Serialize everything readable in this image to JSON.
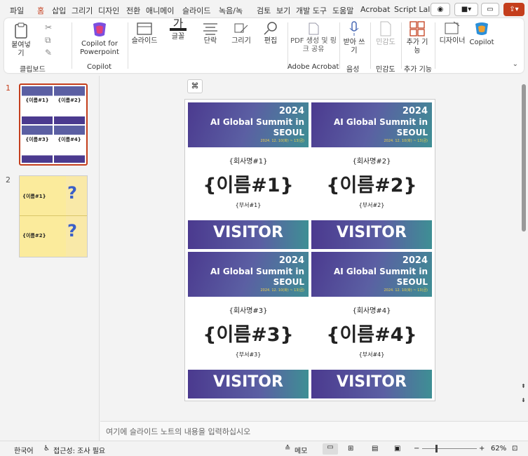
{
  "tabs": [
    "파일",
    "홈",
    "삽입",
    "그리기",
    "디자인",
    "전환",
    "애니메이",
    "슬라이드",
    "녹음/녹",
    "검토",
    "보기",
    "개발 도구",
    "도움말",
    "Acrobat",
    "Script Lal"
  ],
  "ribbon": {
    "paste": "붙여넣기",
    "copilot_pp": "Copilot for Powerpoint",
    "slide": "슬라이드",
    "font": "글꼴",
    "paragraph": "단락",
    "drawing": "그리기",
    "editing": "편집",
    "pdf": "PDF 생성 및 링크 공유",
    "dictate": "받아 쓰기",
    "sensitivity": "민감도",
    "addins": "추가 기능",
    "designer": "디자이너",
    "copilot": "Copilot",
    "groups": [
      "클립보드",
      "Copilot",
      "Adobe Acrobat",
      "음성",
      "민감도",
      "추가 기능"
    ]
  },
  "thumbs": {
    "n1": "1",
    "n2": "2",
    "t1": [
      "{이름#1}",
      "{이름#2}",
      "{이름#3}",
      "{이름#4}"
    ],
    "v": "VISITOR",
    "t2": [
      "{이름#1}",
      "{이름#2}"
    ]
  },
  "badges": [
    {
      "year": "2024",
      "title": "AI Global Summit in SEOUL",
      "date": "2024. 12. 10(화) ~ 13(금)",
      "company": "{회사명#1}",
      "name": "{이름#1}",
      "dept": "{부서#1}",
      "visitor": "VISITOR"
    },
    {
      "year": "2024",
      "title": "AI Global Summit in SEOUL",
      "date": "2024. 12. 10(화) ~ 13(금)",
      "company": "{회사명#2}",
      "name": "{이름#2}",
      "dept": "{부서#2}",
      "visitor": "VISITOR"
    },
    {
      "year": "2024",
      "title": "AI Global Summit in SEOUL",
      "date": "2024. 12. 10(화) ~ 13(금)",
      "company": "{회사명#3}",
      "name": "{이름#3}",
      "dept": "{부서#3}",
      "visitor": "VISITOR"
    },
    {
      "year": "2024",
      "title": "AI Global Summit in SEOUL",
      "date": "2024. 12. 10(화) ~ 13(금)",
      "company": "{회사명#4}",
      "name": "{이름#4}",
      "dept": "{부서#4}",
      "visitor": "VISITOR"
    }
  ],
  "notes_placeholder": "여기에 슬라이드 노트의 내용을 입력하십시오",
  "status": {
    "language": "한국어",
    "accessibility": "접근성: 조사 필요",
    "notes": "메모",
    "zoom": "62%"
  },
  "colors": {
    "accent": "#c43e1c",
    "badge_purple": "#4b3a8f",
    "badge_teal": "#3e8f94",
    "gold": "#f2d24a"
  },
  "icons": [
    "record-icon",
    "camera-icon",
    "comment-icon",
    "share-icon",
    "clipboard-icon",
    "cut-icon",
    "copy-icon",
    "format-painter-icon",
    "copilot-icon",
    "slide-layout-icon",
    "font-icon",
    "paragraph-icon",
    "draw-icon",
    "search-icon",
    "pdf-icon",
    "mic-icon",
    "sensitivity-icon",
    "addins-icon",
    "designer-icon",
    "chevron-down-icon"
  ]
}
